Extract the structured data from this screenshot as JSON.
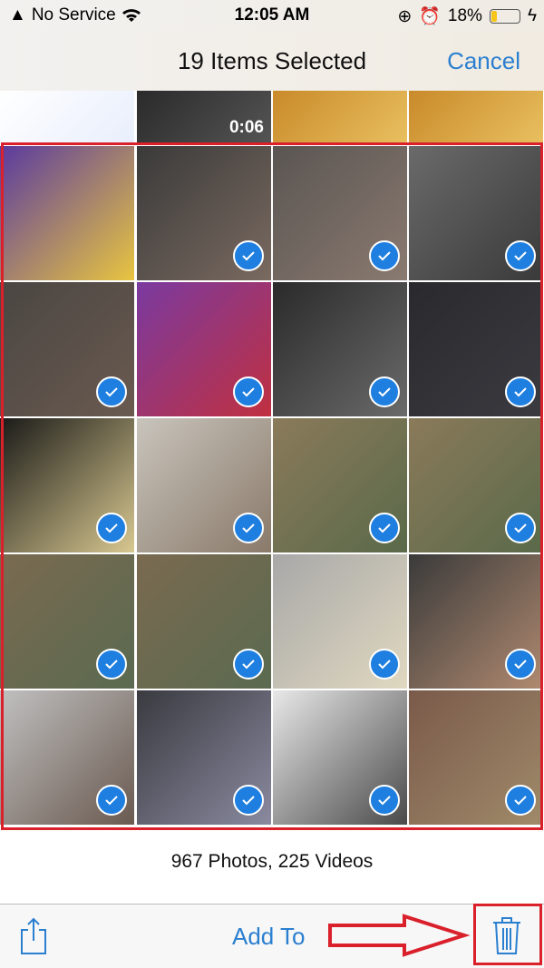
{
  "status_bar": {
    "carrier": "No Service",
    "time": "12:05 AM",
    "battery": "18%",
    "battery_level": 0.18,
    "icons": [
      "warning-icon",
      "wifi-icon",
      "orientation-lock-icon",
      "alarm-icon",
      "battery-icon",
      "charging-icon"
    ]
  },
  "nav": {
    "title": "19 Items Selected",
    "cancel_label": "Cancel"
  },
  "grid": {
    "top_row": [
      {
        "colors": [
          "#ffffff",
          "#e8eefc"
        ],
        "duration": ""
      },
      {
        "colors": [
          "#2a2a2a",
          "#555"
        ],
        "duration": "0:06"
      },
      {
        "colors": [
          "#c98a2a",
          "#e9c060"
        ],
        "duration": ""
      },
      {
        "colors": [
          "#c98a2a",
          "#e9c060"
        ],
        "duration": ""
      }
    ],
    "tiles": [
      {
        "colors": [
          "#5a3aa0",
          "#e8c540"
        ],
        "selected": false
      },
      {
        "colors": [
          "#3a3a3a",
          "#7a6a60"
        ],
        "selected": true
      },
      {
        "colors": [
          "#5a5552",
          "#8a7a70"
        ],
        "selected": true
      },
      {
        "colors": [
          "#6a6a6a",
          "#3a3a3a"
        ],
        "selected": true
      },
      {
        "colors": [
          "#4a4642",
          "#6a5a50"
        ],
        "selected": true
      },
      {
        "colors": [
          "#7a3aa0",
          "#c03040"
        ],
        "selected": true
      },
      {
        "colors": [
          "#2a2a2a",
          "#6a6a6a"
        ],
        "selected": true
      },
      {
        "colors": [
          "#2a2a2e",
          "#3a3a40"
        ],
        "selected": true
      },
      {
        "colors": [
          "#1a1a18",
          "#d8c890"
        ],
        "selected": true
      },
      {
        "colors": [
          "#c8c4bc",
          "#8a7a6a"
        ],
        "selected": true
      },
      {
        "colors": [
          "#8a7a5a",
          "#5a6a4a"
        ],
        "selected": true
      },
      {
        "colors": [
          "#8a7a5a",
          "#5a6a4a"
        ],
        "selected": true
      },
      {
        "colors": [
          "#7a6a50",
          "#5a6a50"
        ],
        "selected": true
      },
      {
        "colors": [
          "#7a6a50",
          "#5a6a50"
        ],
        "selected": true
      },
      {
        "colors": [
          "#a8a8a8",
          "#e0d8c0"
        ],
        "selected": true
      },
      {
        "colors": [
          "#3a3a3a",
          "#b08a70"
        ],
        "selected": true
      },
      {
        "colors": [
          "#c0c0c0",
          "#6a5a50"
        ],
        "selected": true
      },
      {
        "colors": [
          "#3a3a40",
          "#8a8aa0"
        ],
        "selected": true
      },
      {
        "colors": [
          "#e8e8e8",
          "#4a4a4a"
        ],
        "selected": true
      },
      {
        "colors": [
          "#7a5a4a",
          "#a08a6a"
        ],
        "selected": true
      }
    ]
  },
  "footer": {
    "count": "967 Photos, 225 Videos"
  },
  "toolbar": {
    "add_to_label": "Add To"
  },
  "colors": {
    "accent": "#2a7fd0",
    "check": "#1f7fe0",
    "annotation": "#d9202b"
  }
}
